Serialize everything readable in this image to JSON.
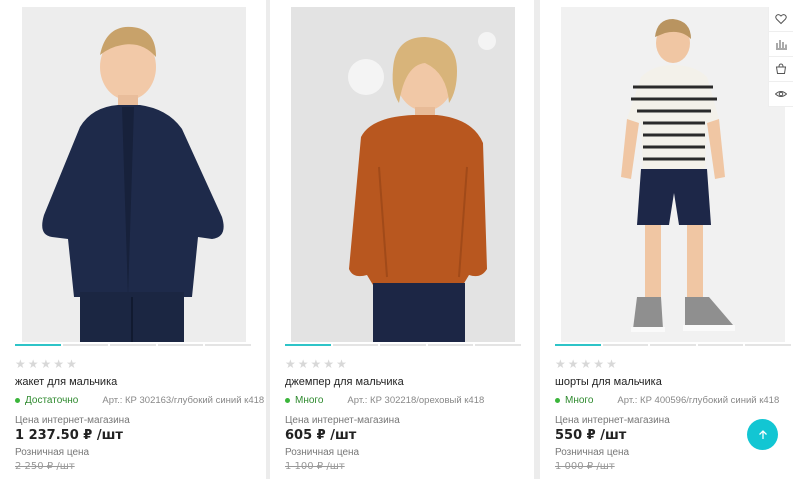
{
  "colors": {
    "accent": "#12c6d3",
    "stock_dot": "#3bb53b",
    "indicator_active": "#2ec4c8"
  },
  "products": [
    {
      "name": "жакет для мальчика",
      "stock": "Достаточно",
      "article": "Арт.: КР 302163/глубокий синий к418",
      "online_price_label": "Цена интернет-магазина",
      "online_price": "1 237.50 ₽ /шт",
      "retail_price_label": "Розничная цена",
      "retail_price": "2 250 ₽ /шт",
      "rating": 0,
      "image_icon": "boy-navy-bomber-jacket-photo"
    },
    {
      "name": "джемпер для мальчика",
      "stock": "Много",
      "article": "Арт.: КР 302218/ореховый к418",
      "online_price_label": "Цена интернет-магазина",
      "online_price": "605 ₽ /шт",
      "retail_price_label": "Розничная цена",
      "retail_price": "1 100 ₽ /шт",
      "rating": 0,
      "image_icon": "boy-orange-jumper-photo"
    },
    {
      "name": "шорты для мальчика",
      "stock": "Много",
      "article": "Арт.: КР 400596/глубокий синий к418",
      "online_price_label": "Цена интернет-магазина",
      "online_price": "550 ₽ /шт",
      "retail_price_label": "Розничная цена",
      "retail_price": "1 000 ₽ /шт",
      "rating": 0,
      "image_icon": "boy-navy-shorts-photo"
    }
  ],
  "actions": [
    "heart-icon",
    "compare-chart-icon",
    "basket-icon",
    "eye-icon"
  ],
  "scroll_top_icon": "arrow-up-icon"
}
